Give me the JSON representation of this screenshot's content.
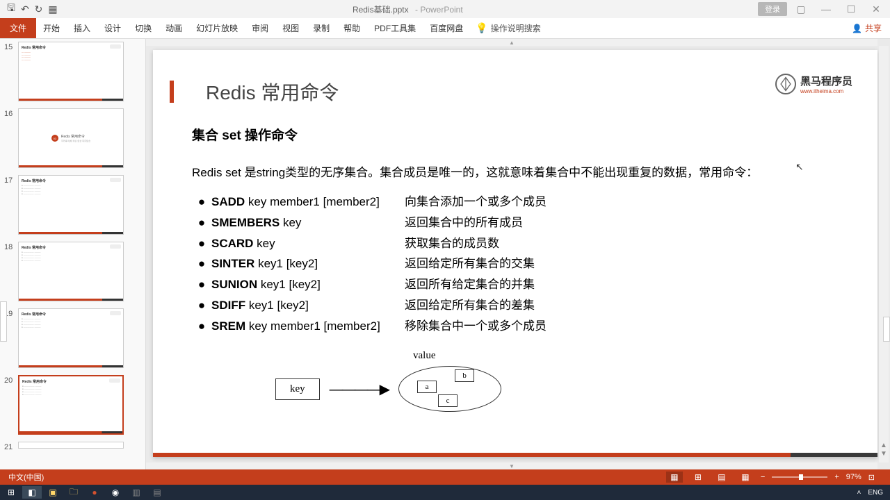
{
  "title_bar": {
    "filename": "Redis基础.pptx",
    "appname": "PowerPoint",
    "login": "登录"
  },
  "ribbon": {
    "file": "文件",
    "tabs": [
      "开始",
      "插入",
      "设计",
      "切换",
      "动画",
      "幻灯片放映",
      "审阅",
      "视图",
      "录制",
      "帮助",
      "PDF工具集",
      "百度网盘"
    ],
    "search_hint": "操作说明搜索",
    "share": "共享"
  },
  "thumbs": {
    "start_index": 15,
    "items": [
      15,
      16,
      17,
      18,
      19,
      20,
      21
    ],
    "selected": 20
  },
  "slide": {
    "title": "Redis 常用命令",
    "subtitle": "集合 set 操作命令",
    "para": "Redis set 是string类型的无序集合。集合成员是唯一的，这就意味着集合中不能出现重复的数据，常用命令：",
    "rows": [
      {
        "cmd": "SADD",
        "args": " key member1 [member2]",
        "desc": "向集合添加一个或多个成员"
      },
      {
        "cmd": "SMEMBERS",
        "args": " key",
        "desc": "返回集合中的所有成员"
      },
      {
        "cmd": "SCARD",
        "args": " key",
        "desc": "获取集合的成员数"
      },
      {
        "cmd": "SINTER",
        "args": " key1 [key2]",
        "desc": "返回给定所有集合的交集"
      },
      {
        "cmd": "SUNION",
        "args": " key1 [key2]",
        "desc": "返回所有给定集合的并集"
      },
      {
        "cmd": "SDIFF",
        "args": " key1 [key2]",
        "desc": "返回给定所有集合的差集"
      },
      {
        "cmd": "SREM",
        "args": " key member1 [member2]",
        "desc": "移除集合中一个或多个成员"
      }
    ],
    "diagram": {
      "value_label": "value",
      "key_label": "key",
      "cells": [
        "a",
        "b",
        "c"
      ]
    },
    "logo": {
      "text": "黑马程序员",
      "url": "www.itheima.com"
    }
  },
  "status": {
    "lang": "中文(中国)",
    "zoom": "97%"
  },
  "taskbar": {
    "ime": "ENG",
    "caret": "˄"
  }
}
